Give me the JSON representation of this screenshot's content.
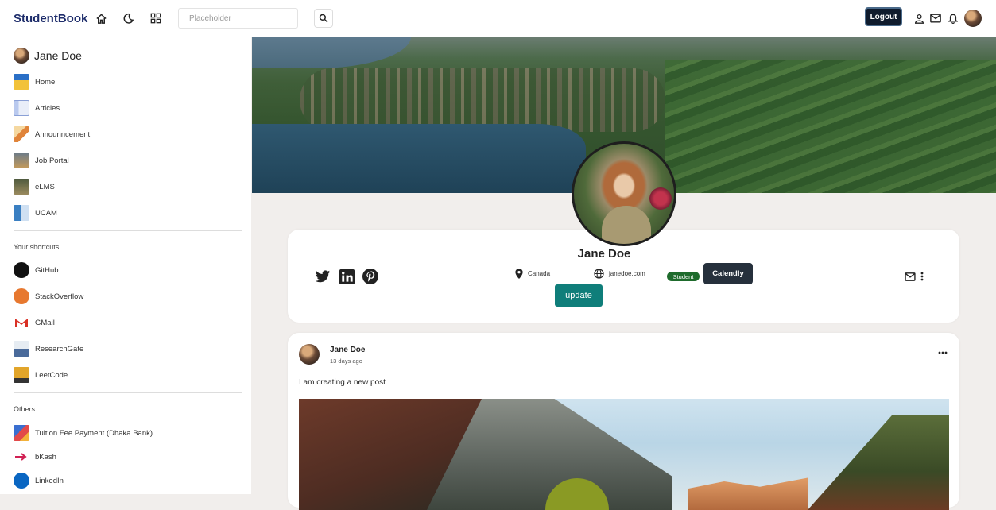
{
  "topbar": {
    "brand": "StudentBook",
    "search_placeholder": "Placeholder",
    "logout_label": "Logout"
  },
  "sidebar": {
    "user_name": "Jane Doe",
    "items": [
      {
        "label": "Home",
        "icon": "home-icon"
      },
      {
        "label": "Articles",
        "icon": "articles-icon"
      },
      {
        "label": "Announncement",
        "icon": "announcement-icon"
      },
      {
        "label": "Job Portal",
        "icon": "job-portal-icon"
      },
      {
        "label": "eLMS",
        "icon": "elms-icon"
      },
      {
        "label": "UCAM",
        "icon": "ucam-icon"
      }
    ],
    "shortcuts_heading": "Your shortcuts",
    "shortcuts": [
      {
        "label": "GitHub",
        "icon": "github-icon"
      },
      {
        "label": "StackOverflow",
        "icon": "stackoverflow-icon"
      },
      {
        "label": "GMail",
        "icon": "gmail-icon"
      },
      {
        "label": "ResearchGate",
        "icon": "researchgate-icon"
      },
      {
        "label": "LeetCode",
        "icon": "leetcode-icon"
      }
    ],
    "others_heading": "Others",
    "others": [
      {
        "label": "Tuition Fee Payment (Dhaka Bank)",
        "icon": "tuition-icon"
      },
      {
        "label": "bKash",
        "icon": "bkash-icon"
      },
      {
        "label": "LinkedIn",
        "icon": "linkedin-icon"
      }
    ]
  },
  "profile": {
    "name": "Jane Doe",
    "location": "Canada",
    "website": "janedoe.com",
    "badge": "Student",
    "calendly_label": "Calendly",
    "update_label": "update"
  },
  "post": {
    "author": "Jane Doe",
    "time": "13 days ago",
    "text": "I am creating a new post"
  },
  "colors": {
    "brand": "#1e2d6b",
    "accent": "#0f7e7a",
    "badge": "#1e6b2c",
    "dark_button": "#26303c"
  }
}
